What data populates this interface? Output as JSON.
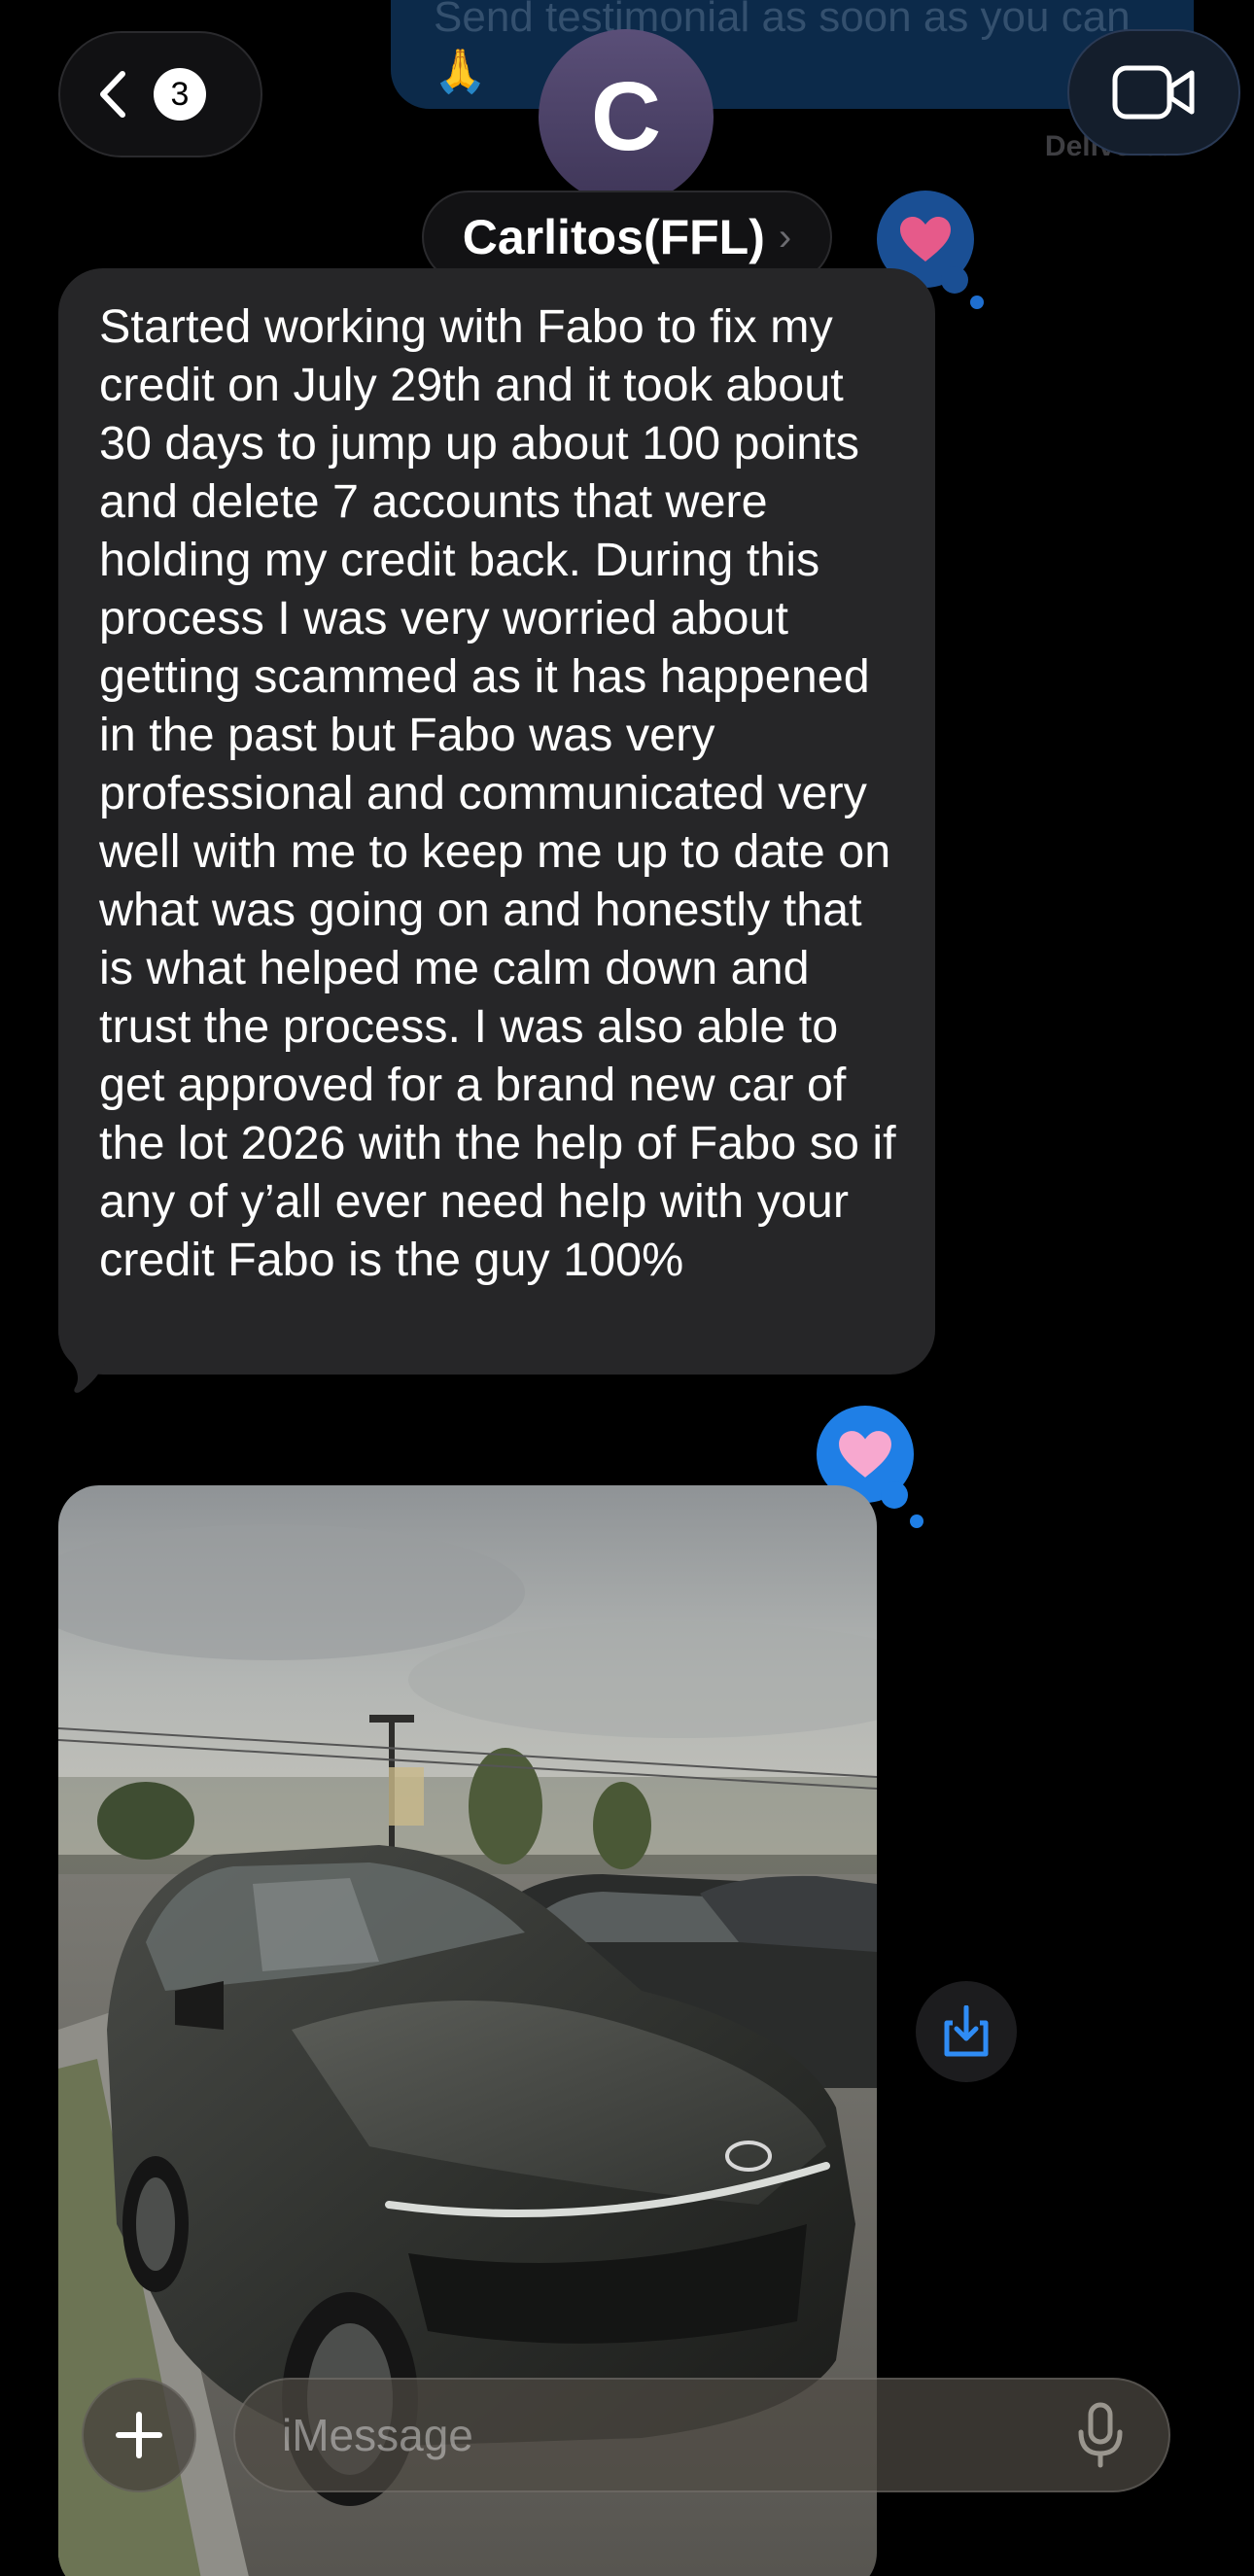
{
  "previous_message": {
    "text": "Send testimonial as soon as you can 🙏",
    "status": "Delivered"
  },
  "header": {
    "unread_count": "3",
    "contact_initial": "C",
    "contact_name": "Carlitos(FFL)",
    "name_chevron": "›"
  },
  "message": {
    "text": "Started working with Fabo to fix my credit on July 29th and it took about 30 days to jump up about 100 points and delete 7 accounts that were holding my credit back. During this process I was very worried about getting scammed as it has happened in the past but Fabo was very professional and communicated very well with me to keep me up to date on what was going on and honestly that is what helped me calm down and trust the process. I was also able to get approved for a brand new car of the lot 2026 with the help of Fabo so if any of y’all ever need help with your credit Fabo is the guy 100%",
    "reaction": "heart"
  },
  "photo_message": {
    "subject": "dark gray sedan parked in a dealership lot",
    "reaction": "heart"
  },
  "compose": {
    "placeholder": "iMessage"
  },
  "icons": [
    "chevron-left-icon",
    "video-camera-icon",
    "heart-icon",
    "save-download-icon",
    "plus-icon",
    "microphone-icon"
  ],
  "colors": {
    "background": "#000000",
    "incoming_bubble": "#262628",
    "accent_blue": "#1f7fe6",
    "avatar": "#4a4066",
    "heart": "#f06292"
  }
}
